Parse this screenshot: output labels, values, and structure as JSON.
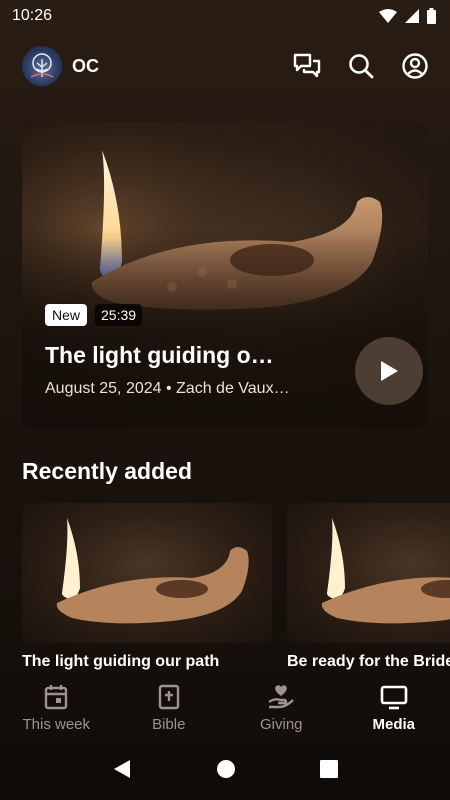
{
  "status_bar": {
    "time": "10:26"
  },
  "header": {
    "org_initials": "OC"
  },
  "hero": {
    "badge_new": "New",
    "duration": "25:39",
    "title": "The light guiding o…",
    "meta": "August 25, 2024 • Zach de Vaux…"
  },
  "recently_added": {
    "title": "Recently added",
    "items": [
      {
        "title": "The light guiding our path"
      },
      {
        "title": "Be ready for the Bride"
      }
    ]
  },
  "bottom_nav": {
    "items": [
      {
        "label": "This week",
        "icon": "calendar-icon"
      },
      {
        "label": "Bible",
        "icon": "bible-icon"
      },
      {
        "label": "Giving",
        "icon": "giving-icon"
      },
      {
        "label": "Media",
        "icon": "tv-icon"
      }
    ],
    "active": "Media"
  },
  "colors": {
    "background": "#1c140e",
    "active_nav": "#ffffff",
    "inactive_nav": "#9b948e"
  }
}
